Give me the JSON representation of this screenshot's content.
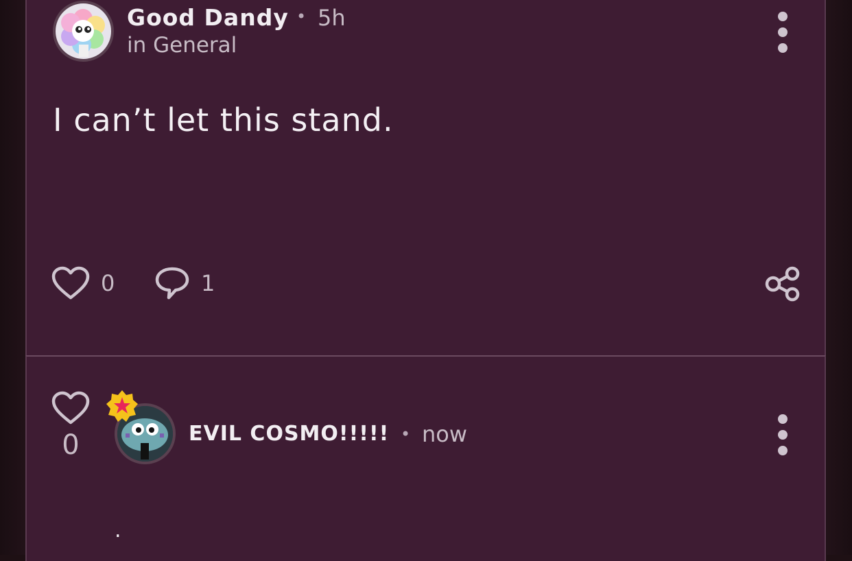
{
  "post": {
    "author": "Good Dandy",
    "separator": "•",
    "time": "5h",
    "category": "in General",
    "body": "I can’t let this stand.",
    "likes": "0",
    "comments": "1"
  },
  "comment": {
    "author": "EVIL COSMO!!!!!",
    "separator": "•",
    "time": "now",
    "likes": "0",
    "body": "."
  },
  "icons": {
    "like": "heart-outline-icon",
    "comment": "speech-bubble-icon",
    "share": "share-icon",
    "more": "vertical-ellipsis-icon",
    "badge": "star-badge-icon"
  },
  "colors": {
    "card_background": "#3e1c33",
    "page_background": "#1e1014",
    "text_primary": "#f2eef2",
    "text_secondary": "#c8bcc6",
    "badge_gold": "#f5c21b",
    "badge_star": "#e8265a"
  }
}
